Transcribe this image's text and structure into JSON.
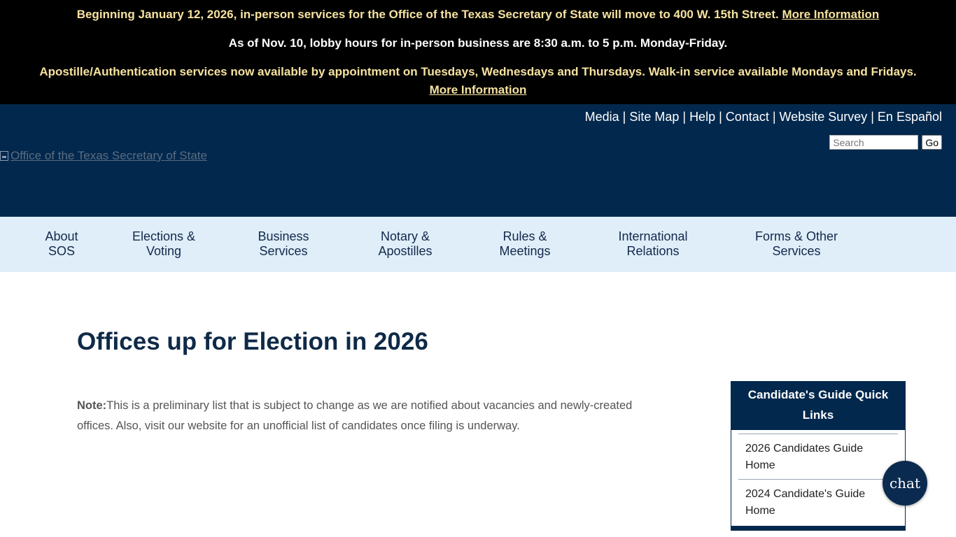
{
  "alerts": {
    "line1_text": "Beginning January 12, 2026, in-person services for the Office of the Texas Secretary of State will move to 400 W. 15th Street. ",
    "line1_link": "More Information",
    "line2_text": "As of Nov. 10, lobby hours for in-person business are 8:30 a.m. to 5 p.m. Monday-Friday.",
    "line3_text": "Apostille/Authentication services now available by appointment on Tuesdays, Wednesdays and Thursdays. Walk-in service available Mondays and Fridays. ",
    "line3_link": "More Information"
  },
  "utility": {
    "media": "Media",
    "site_map": "Site Map",
    "help": "Help",
    "contact": "Contact",
    "survey": "Website Survey",
    "espanol": "En Español",
    "separator": "|"
  },
  "search": {
    "placeholder": "Search",
    "button": "Go"
  },
  "logo": {
    "alt": "Office of the Texas Secretary of State"
  },
  "nav": {
    "items": [
      {
        "label": "About\nSOS"
      },
      {
        "label": "Elections &\nVoting"
      },
      {
        "label": "Business\nServices"
      },
      {
        "label": "Notary &\nApostilles"
      },
      {
        "label": "Rules &\nMeetings"
      },
      {
        "label": "International\nRelations"
      },
      {
        "label": "Forms & Other\nServices"
      }
    ]
  },
  "main": {
    "title": "Offices up for Election in 2026",
    "note_label": "Note:",
    "note_text": "This is a preliminary list that is subject to change as we are notified about vacancies and newly-created offices. Also, visit our website for an unofficial list of candidates once filing is underway."
  },
  "quick_links": {
    "title": "Candidate's Guide Quick Links",
    "items": [
      {
        "label": "2026 Candidates Guide Home"
      },
      {
        "label": "2024 Candidate's Guide Home"
      }
    ]
  },
  "chat": {
    "label": "chat"
  },
  "colors": {
    "header_navy": "#03284d",
    "nav_bg": "#dfeef9",
    "alert_yellow": "#f6e29f"
  }
}
